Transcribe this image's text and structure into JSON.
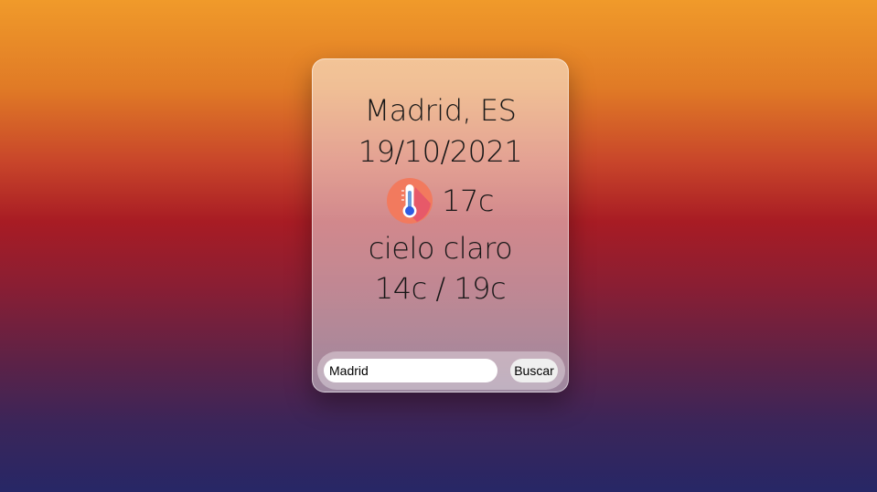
{
  "weather": {
    "location": "Madrid, ES",
    "date": "19/10/2021",
    "temperature": "17c",
    "description": "cielo claro",
    "min_max": "14c / 19c",
    "icon": "thermometer-icon"
  },
  "search": {
    "value": "Madrid",
    "button_label": "Buscar"
  },
  "colors": {
    "background_top": "#f09a2a",
    "background_middle": "#a81c24",
    "background_bottom": "#272766",
    "thermometer_circle": "#f27a5e",
    "thermometer_mercury": "#2f5be0"
  }
}
